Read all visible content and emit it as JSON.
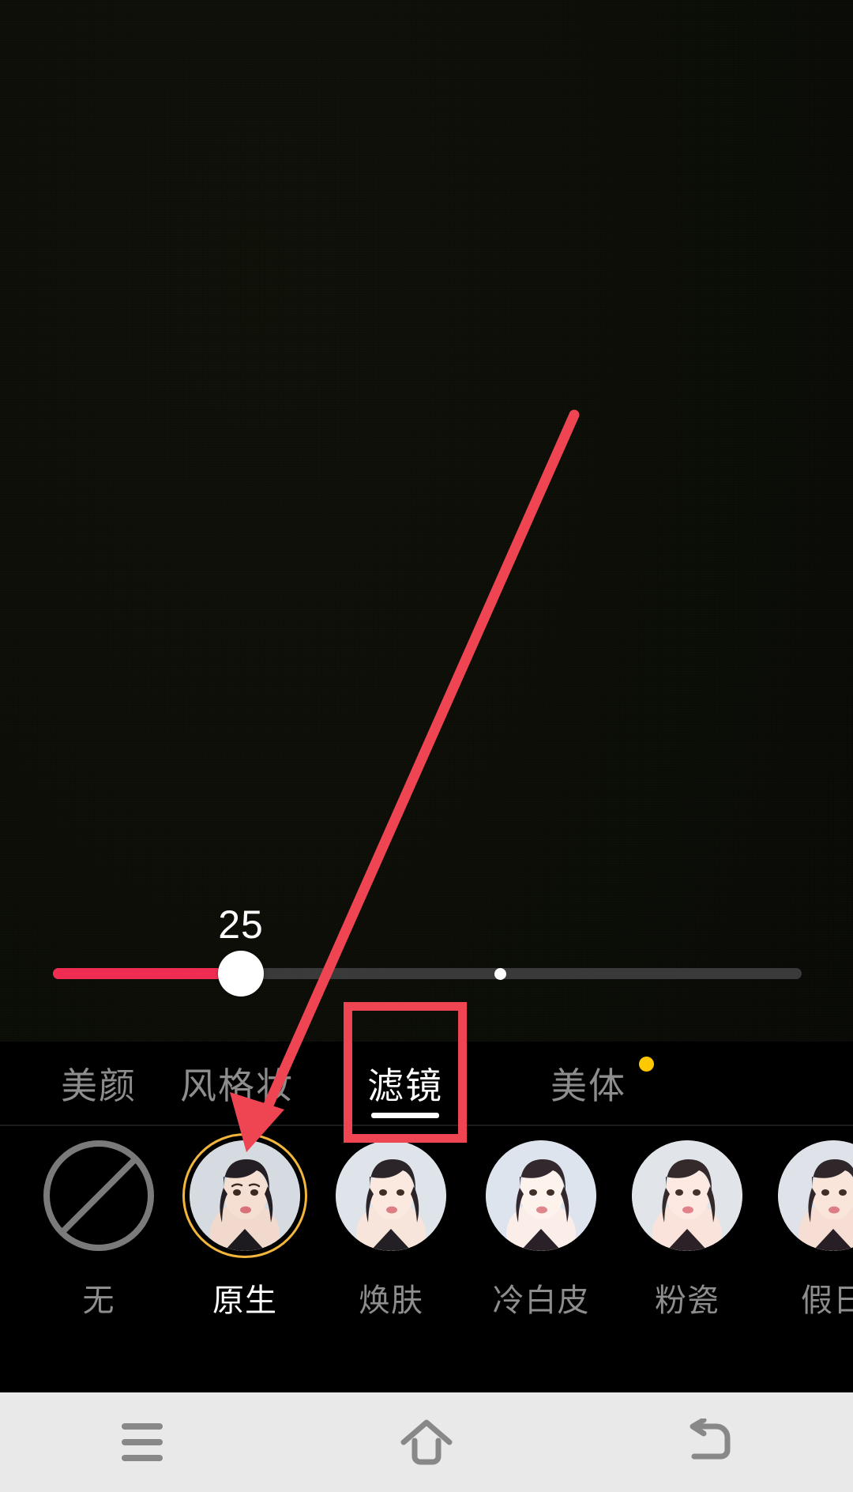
{
  "app": {
    "screen_name": "beauty-camera-filter-panel",
    "background_color": "#0a0c06"
  },
  "slider": {
    "name": "filter-intensity-slider",
    "value": "25",
    "min": 0,
    "max": 100,
    "fill_color": "#ef2d52",
    "track_color": "#3a3a3a",
    "thumb_color": "#ffffff",
    "marker_label": ""
  },
  "tabs": {
    "active_index": 2,
    "items": [
      {
        "label": "美颜",
        "name": "tab-beauty",
        "active": false,
        "badge": false
      },
      {
        "label": "风格妆",
        "name": "tab-style-makeup",
        "active": false,
        "badge": false
      },
      {
        "label": "滤镜",
        "name": "tab-filter",
        "active": true,
        "badge": false
      },
      {
        "label": "美体",
        "name": "tab-body",
        "active": false,
        "badge": true
      }
    ],
    "badge_color": "#ffc800",
    "active_color": "#ffffff",
    "inactive_color": "#8d8d8d"
  },
  "filters": {
    "selected_index": 1,
    "selected_ring_color": "#f3b63c",
    "items": [
      {
        "label": "无",
        "name": "filter-none",
        "icon": "ban-icon",
        "selected": false
      },
      {
        "label": "原生",
        "name": "filter-original",
        "icon": "portrait-thumb",
        "selected": true
      },
      {
        "label": "焕肤",
        "name": "filter-renew-skin",
        "icon": "portrait-thumb",
        "selected": false
      },
      {
        "label": "冷白皮",
        "name": "filter-cool-white",
        "icon": "portrait-thumb",
        "selected": false
      },
      {
        "label": "粉瓷",
        "name": "filter-pink-porcelain",
        "icon": "portrait-thumb",
        "selected": false
      },
      {
        "label": "假日",
        "name": "filter-holiday",
        "icon": "portrait-thumb",
        "selected": false
      }
    ]
  },
  "annotation": {
    "color": "#ef4452",
    "highlight_target": "滤镜",
    "arrow_from": "top-right",
    "arrow_to": "filter-original"
  },
  "navbar": {
    "background_color": "#e9e9e9",
    "icon_color": "#888888",
    "items": [
      {
        "label": "",
        "name": "nav-menu-button",
        "icon": "menu-icon"
      },
      {
        "label": "",
        "name": "nav-home-button",
        "icon": "home-icon"
      },
      {
        "label": "",
        "name": "nav-back-button",
        "icon": "back-icon"
      }
    ]
  }
}
